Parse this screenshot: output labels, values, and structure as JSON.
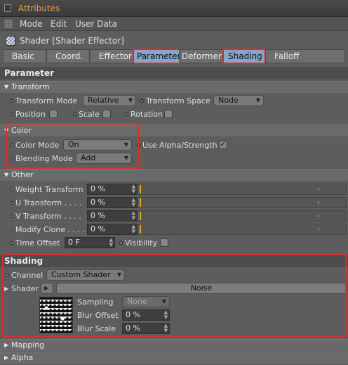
{
  "window": {
    "title": "Attributes"
  },
  "menu": {
    "items": [
      "Mode",
      "Edit",
      "User Data"
    ]
  },
  "header": {
    "title": "Shader [Shader Effector]"
  },
  "tabs": [
    {
      "label": "Basic"
    },
    {
      "label": "Coord."
    },
    {
      "label": "Effector"
    },
    {
      "label": "Parameter"
    },
    {
      "label": "Deformer"
    },
    {
      "label": "Shading"
    },
    {
      "label": "Falloff"
    }
  ],
  "parameter": {
    "section_title": "Parameter",
    "transform": {
      "group_title": "Transform",
      "mode_label": "Transform Mode",
      "mode_value": "Relative",
      "space_label": "Transform Space",
      "space_value": "Node",
      "position_label": "Position",
      "scale_label": "Scale",
      "rotation_label": "Rotation"
    },
    "color": {
      "group_title": "Color",
      "mode_label": "Color Mode",
      "mode_value": "On",
      "alpha_label": "Use Alpha/Strength",
      "alpha_check": "✓",
      "blend_label": "Blending Mode",
      "blend_value": "Add"
    },
    "other": {
      "group_title": "Other",
      "weight_label": "Weight Transform",
      "weight_value": "0 %",
      "u_label": "U Transform . . . .",
      "u_value": "0 %",
      "v_label": "V Transform . . . .",
      "v_value": "0 %",
      "modify_label": "Modify Clone . . . .",
      "modify_value": "0 %",
      "offset_label": "Time Offset",
      "offset_value": "0 F",
      "visibility_label": "Visibility"
    }
  },
  "shading": {
    "section_title": "Shading",
    "channel_label": "Channel",
    "channel_value": "Custom Shader",
    "shader_label": "Shader",
    "shader_name": "Noise",
    "sampling_label": "Sampling",
    "sampling_value": "None",
    "blur_offset_label": "Blur Offset",
    "blur_offset_value": "0 %",
    "blur_scale_label": "Blur Scale",
    "blur_scale_value": "0 %"
  },
  "collapsed": {
    "mapping": "Mapping",
    "alpha": "Alpha"
  },
  "colors": {
    "accent_orange": "#e8a040",
    "active_tab": "#8aa4c4",
    "highlight_red": "#d33030",
    "slider_marker": "#e8b020"
  }
}
